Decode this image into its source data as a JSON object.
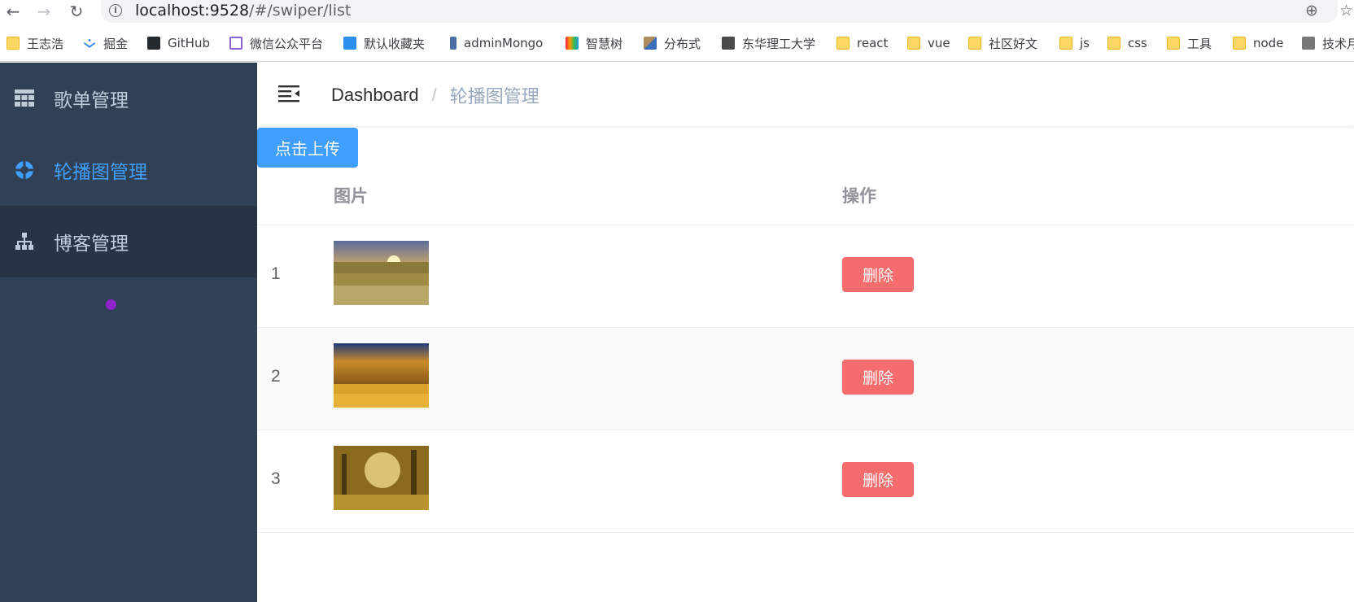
{
  "browser": {
    "url_host": "localhost:9528",
    "url_path": "/#/swiper/list",
    "bookmarks": [
      {
        "label": "王志浩",
        "icon": "folder-icon"
      },
      {
        "label": "掘金",
        "icon": "juejin-icon"
      },
      {
        "label": "GitHub",
        "icon": "github-icon"
      },
      {
        "label": "微信公众平台",
        "icon": "wechat-mp-icon"
      },
      {
        "label": "默认收藏夹",
        "icon": "bilibili-icon"
      },
      {
        "label": "adminMongo",
        "icon": "mongo-icon"
      },
      {
        "label": "智慧树",
        "icon": "zhihuishu-icon"
      },
      {
        "label": "分布式",
        "icon": "distributed-icon"
      },
      {
        "label": "东华理工大学",
        "icon": "globe-icon"
      },
      {
        "label": "react",
        "icon": "folder-icon"
      },
      {
        "label": "vue",
        "icon": "folder-icon"
      },
      {
        "label": "社区好文",
        "icon": "folder-icon"
      },
      {
        "label": "js",
        "icon": "folder-icon"
      },
      {
        "label": "css",
        "icon": "folder-icon"
      },
      {
        "label": "工具",
        "icon": "folder-icon"
      },
      {
        "label": "node",
        "icon": "folder-icon"
      },
      {
        "label": "技术月",
        "icon": "avatar-icon"
      }
    ]
  },
  "sidebar": {
    "items": [
      {
        "label": "歌单管理",
        "icon": "table-grid-icon"
      },
      {
        "label": "轮播图管理",
        "icon": "carousel-icon"
      },
      {
        "label": "博客管理",
        "icon": "sitemap-icon"
      }
    ]
  },
  "header": {
    "breadcrumb_home": "Dashboard",
    "breadcrumb_sep": "/",
    "breadcrumb_current": "轮播图管理"
  },
  "toolbar": {
    "upload_label": "点击上传"
  },
  "table": {
    "columns": [
      "图片",
      "操作"
    ],
    "rows": [
      {
        "index": "1",
        "action": "删除"
      },
      {
        "index": "2",
        "action": "删除"
      },
      {
        "index": "3",
        "action": "删除"
      }
    ]
  },
  "colors": {
    "sidebar_bg": "#304156",
    "accent": "#409eff",
    "danger": "#f56c6c"
  }
}
